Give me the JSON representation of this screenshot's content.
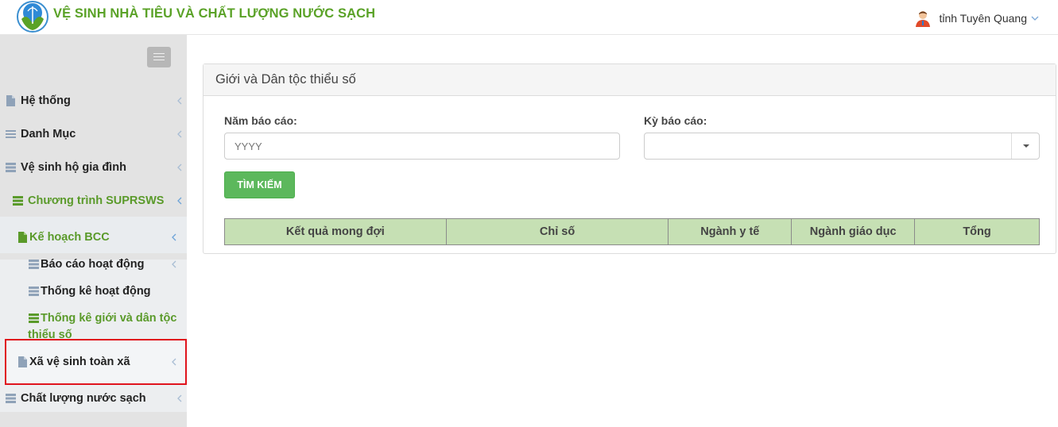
{
  "header": {
    "title": "VỆ SINH NHÀ TIÊU VÀ CHẤT LƯỢNG NƯỚC SẠCH",
    "user_name": "tỉnh Tuyên Quang"
  },
  "sidebar": {
    "items": [
      {
        "label": "Hệ thống"
      },
      {
        "label": "Danh Mục"
      },
      {
        "label": "Vệ sinh hộ gia đình"
      },
      {
        "label": "Chương trình SUPRSWS"
      },
      {
        "label": "Kế hoạch BCC"
      },
      {
        "label": "Báo cáo hoạt động"
      },
      {
        "label": "Thống kê hoạt động"
      },
      {
        "label": "Thống kê giới và dân tộc",
        "label2": "thiểu số"
      },
      {
        "label": "Xã vệ sinh toàn xã"
      },
      {
        "label": "Chất lượng nước sạch"
      }
    ]
  },
  "panel": {
    "title": "Giới và Dân tộc thiểu số",
    "year_label": "Năm báo cáo:",
    "year_placeholder": "YYYY",
    "period_label": "Kỳ báo cáo:",
    "period_value": "",
    "search_button": "TÌM KIẾM",
    "table_headers": [
      "Kết quả mong đợi",
      "Chỉ số",
      "Ngành y tế",
      "Ngành giáo dục",
      "Tổng"
    ]
  },
  "colors": {
    "brand_green": "#5aa227",
    "button_green": "#5cb85c",
    "table_header_bg": "#c6e0b4",
    "highlight_red": "#e0141d"
  }
}
